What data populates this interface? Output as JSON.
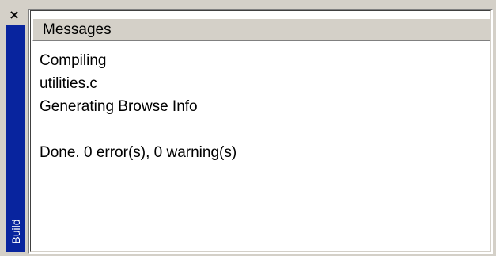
{
  "panel": {
    "side_tab_label": "Build",
    "close_symbol": "×",
    "column_header": "Messages"
  },
  "messages": [
    "Compiling",
    "utilities.c",
    "Generating Browse Info",
    "",
    "Done. 0 error(s), 0 warning(s)"
  ],
  "colors": {
    "side_bar": "#08249e",
    "chrome": "#d4d0c8",
    "content_background": "#ffffff"
  },
  "icons": {
    "close": "close-icon"
  }
}
